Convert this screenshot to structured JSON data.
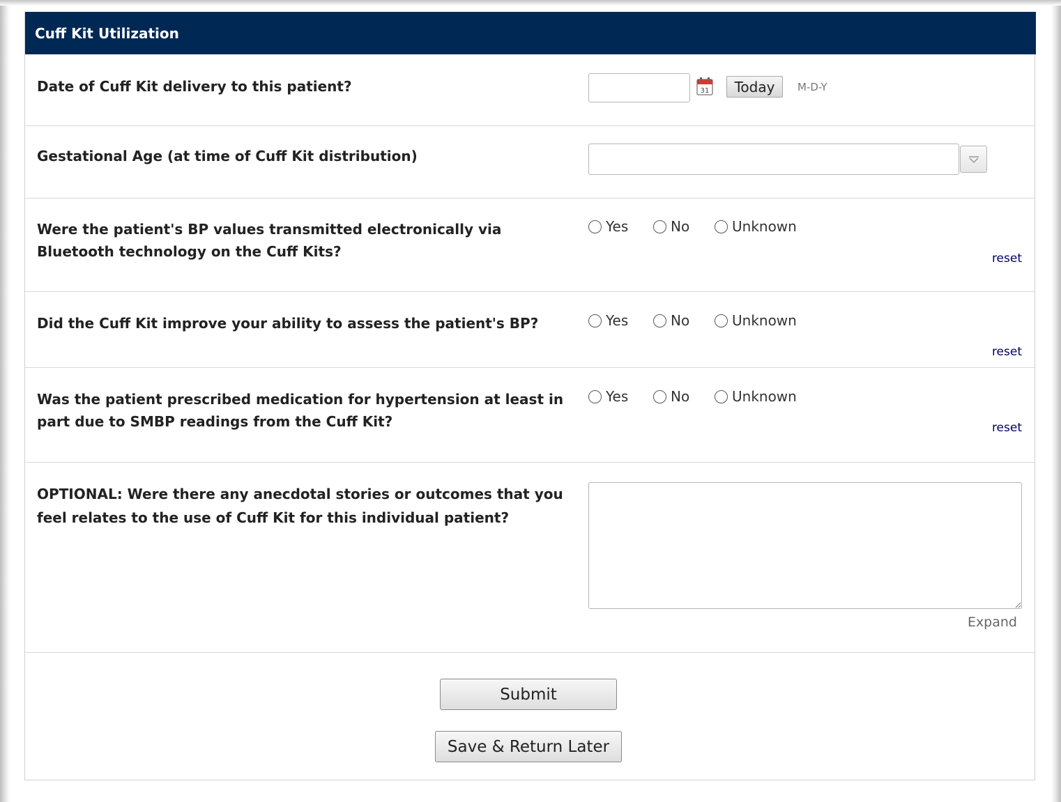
{
  "form": {
    "title": "Cuff Kit Utilization",
    "date_question": {
      "label": "Date of Cuff Kit delivery to this patient?",
      "value": "",
      "today_label": "Today",
      "format_hint": "M-D-Y"
    },
    "gestational_question": {
      "label": "Gestational Age (at time of Cuff Kit distribution)",
      "selected": ""
    },
    "radio_questions": [
      {
        "label": "Were the patient's BP values transmitted electronically via Bluetooth technology on the Cuff Kits?",
        "options": [
          "Yes",
          "No",
          "Unknown"
        ],
        "reset_label": "reset"
      },
      {
        "label": "Did the Cuff Kit improve your ability to assess the patient's BP?",
        "options": [
          "Yes",
          "No",
          "Unknown"
        ],
        "reset_label": "reset"
      },
      {
        "label": "Was the patient prescribed medication for hypertension at least in part due to SMBP readings from the Cuff Kit?",
        "options": [
          "Yes",
          "No",
          "Unknown"
        ],
        "reset_label": "reset"
      }
    ],
    "optional_question": {
      "label": "OPTIONAL: Were there any anecdotal stories or outcomes that you feel relates to the use of Cuff Kit for this individual patient?",
      "value": "",
      "expand_label": "Expand"
    },
    "actions": {
      "submit_label": "Submit",
      "save_return_label": "Save & Return Later"
    }
  },
  "colors": {
    "header_bg": "#002855",
    "header_text": "#ffffff",
    "reset_link": "#000066"
  },
  "icons": {
    "calendar": "calendar-icon",
    "dropdown": "chevron-down-icon"
  }
}
